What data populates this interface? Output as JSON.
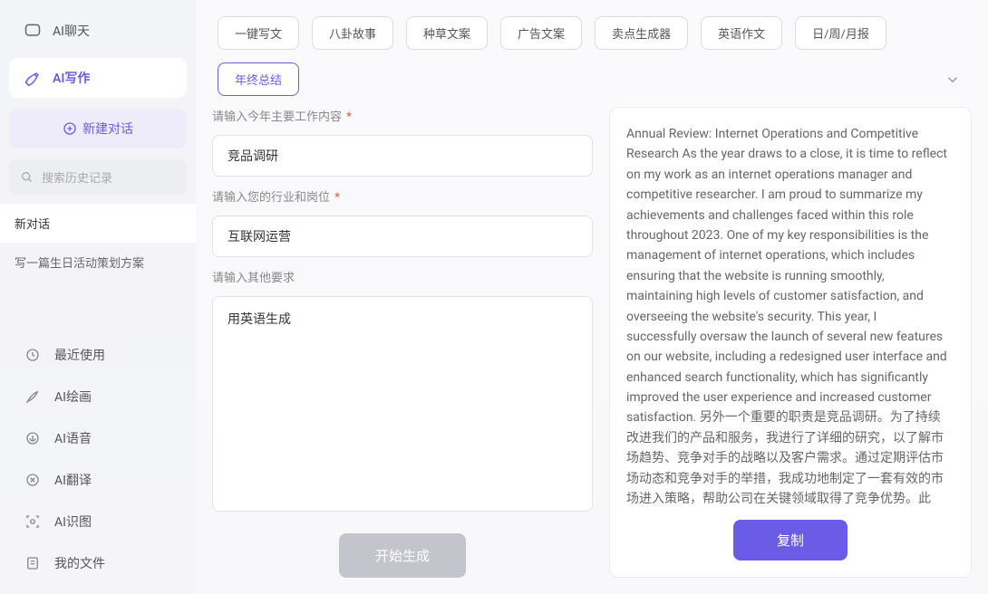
{
  "sidebar": {
    "nav": [
      {
        "label": "AI聊天",
        "icon": "chat"
      },
      {
        "label": "AI写作",
        "icon": "write"
      }
    ],
    "new_chat_label": "新建对话",
    "search_placeholder": "搜索历史记录",
    "history": [
      {
        "label": "新对话"
      },
      {
        "label": "写一篇生日活动策划方案"
      }
    ],
    "tools": [
      {
        "label": "最近使用",
        "icon": "clock"
      },
      {
        "label": "AI绘画",
        "icon": "brush"
      },
      {
        "label": "AI语音",
        "icon": "audio"
      },
      {
        "label": "AI翻译",
        "icon": "translate"
      },
      {
        "label": "AI识图",
        "icon": "scan"
      },
      {
        "label": "我的文件",
        "icon": "file"
      }
    ]
  },
  "tabs": [
    "一键写文",
    "八卦故事",
    "种草文案",
    "广告文案",
    "卖点生成器",
    "英语作文",
    "日/周/月报",
    "年终总结"
  ],
  "active_tab": "年终总结",
  "form": {
    "label1": "请输入今年主要工作内容",
    "value1": "竞品调研",
    "label2": "请输入您的行业和岗位",
    "value2": "互联网运营",
    "label3": "请输入其他要求",
    "value3": "用英语生成",
    "submit_label": "开始生成"
  },
  "output": {
    "text": "Annual Review: Internet Operations and Competitive Research As the year draws to a close, it is time to reflect on my work as an internet operations manager and competitive researcher. I am proud to summarize my achievements and challenges faced within this role throughout 2023. One of my key responsibilities is the management of internet operations, which includes ensuring that the website is running smoothly, maintaining high levels of customer satisfaction, and overseeing the website's security. This year, I successfully oversaw the launch of several new features on our website, including a redesigned user interface and enhanced search functionality, which has significantly improved the user experience and increased customer satisfaction. 另外一个重要的职责是竞品调研。为了持续改进我们的产品和服务，我进行了详细的研究，以了解市场趋势、竞争对手的战略以及客户需求。通过定期评估市场动态和竞争对手的举措，我成功地制定了一套有效的市场进入策略，帮助公司在关键领域取得了竞争优势。此外，我还与跨职能团队合作，成功实施了一系列优化措施，以提高我们产品的性能和用户体验。 One of my key achievements this year was the development of a comprehensive c",
    "copy_label": "复制"
  }
}
